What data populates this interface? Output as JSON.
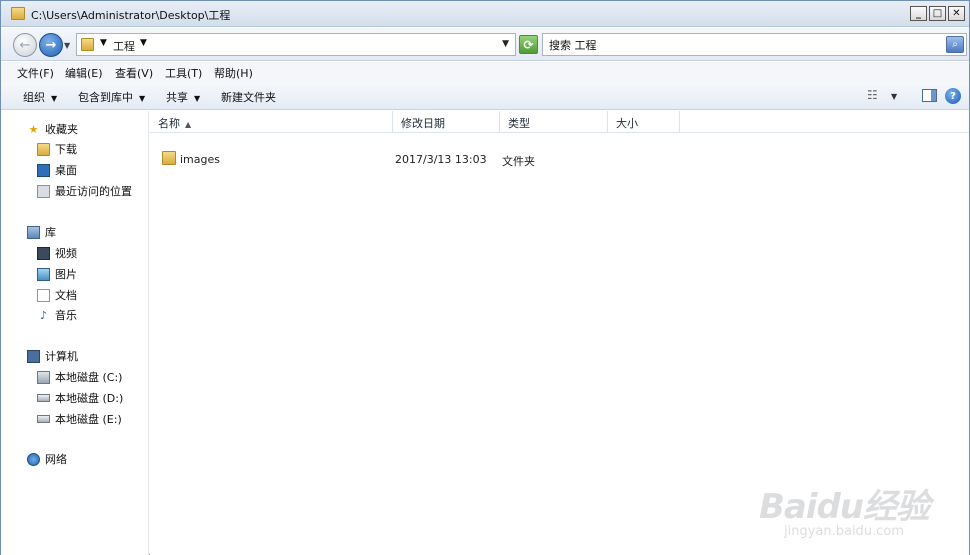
{
  "window": {
    "title": "C:\\Users\\Administrator\\Desktop\\工程",
    "controls": {
      "minimize": "_",
      "maximize": "□",
      "close": "✕"
    }
  },
  "address": {
    "crumbs": [
      "工程"
    ],
    "search_value": "搜索 工程"
  },
  "menubar": {
    "items": [
      "文件(F)",
      "编辑(E)",
      "查看(V)",
      "工具(T)",
      "帮助(H)"
    ]
  },
  "toolbar": {
    "organize": "组织",
    "include_in_library": "包含到库中",
    "share": "共享",
    "new_folder": "新建文件夹"
  },
  "navpane": {
    "favorites": {
      "label": "收藏夹",
      "items": [
        "下载",
        "桌面",
        "最近访问的位置"
      ]
    },
    "libraries": {
      "label": "库",
      "items": [
        "视频",
        "图片",
        "文档",
        "音乐"
      ]
    },
    "computer": {
      "label": "计算机",
      "items": [
        "本地磁盘 (C:)",
        "本地磁盘 (D:)",
        "本地磁盘 (E:)"
      ]
    },
    "network": {
      "label": "网络"
    }
  },
  "columns": [
    "名称",
    "修改日期",
    "类型",
    "大小"
  ],
  "files": [
    {
      "name": "images",
      "modified": "2017/3/13 13:03",
      "type": "文件夹",
      "size": ""
    }
  ],
  "watermark": {
    "logo": "Baidu经验",
    "url": "jingyan.baidu.com"
  },
  "colors": {
    "titlebar": "#d3deeb",
    "nav_forward": "#1f5fb2",
    "folder": "#d9ac3c"
  }
}
